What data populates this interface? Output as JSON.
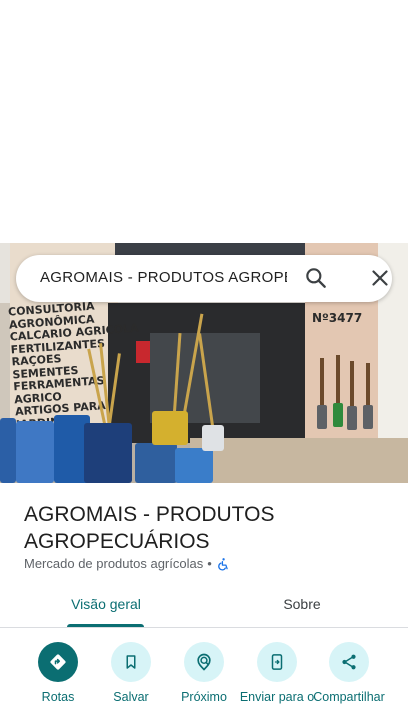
{
  "search": {
    "query": "AGROMAIS - PRODUTOS AGROPECUÁRIOS",
    "search_icon": "search-icon",
    "close_icon": "close-icon"
  },
  "photo": {
    "wall_sign_text": "CONSULTORIA\nAGRONÔMICA\nCALCARIO AGRICOLA\nFERTILIZANTES\nRAÇOES\nSEMENTES\nFERRAMENTAS\nAGRICO\nARTIGOS PARA\nJARDINAGE",
    "street_number": "Nº3477"
  },
  "place": {
    "name": "AGROMAIS - PRODUTOS AGROPECUÁRIOS",
    "category": "Mercado de produtos agrícolas",
    "separator": "•",
    "accessibility_icon": "wheelchair-icon"
  },
  "tabs": [
    {
      "label": "Visão geral",
      "active": true
    },
    {
      "label": "Sobre",
      "active": false
    }
  ],
  "actions": [
    {
      "label": "Rotas",
      "icon": "directions-icon"
    },
    {
      "label": "Salvar",
      "icon": "bookmark-icon"
    },
    {
      "label": "Próximo",
      "icon": "nearby-icon"
    },
    {
      "label": "Enviar para o",
      "icon": "send-to-phone-icon"
    },
    {
      "label": "Compartilhar",
      "icon": "share-icon"
    }
  ],
  "colors": {
    "accent": "#0b6e72",
    "action_bg": "#d7f4f7",
    "text_primary": "#1f1f1f",
    "text_secondary": "#5f6368"
  }
}
